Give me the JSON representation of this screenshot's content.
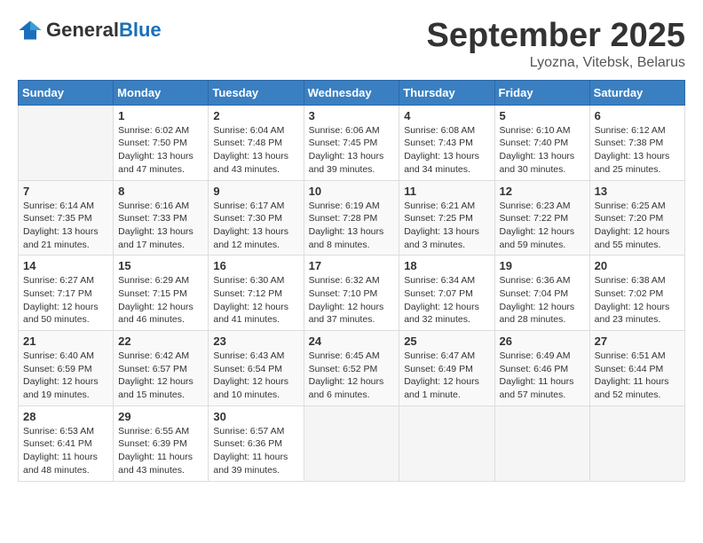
{
  "logo": {
    "general": "General",
    "blue": "Blue"
  },
  "header": {
    "month": "September 2025",
    "location": "Lyozna, Vitebsk, Belarus"
  },
  "weekdays": [
    "Sunday",
    "Monday",
    "Tuesday",
    "Wednesday",
    "Thursday",
    "Friday",
    "Saturday"
  ],
  "weeks": [
    [
      {
        "day": "",
        "info": ""
      },
      {
        "day": "1",
        "info": "Sunrise: 6:02 AM\nSunset: 7:50 PM\nDaylight: 13 hours and 47 minutes."
      },
      {
        "day": "2",
        "info": "Sunrise: 6:04 AM\nSunset: 7:48 PM\nDaylight: 13 hours and 43 minutes."
      },
      {
        "day": "3",
        "info": "Sunrise: 6:06 AM\nSunset: 7:45 PM\nDaylight: 13 hours and 39 minutes."
      },
      {
        "day": "4",
        "info": "Sunrise: 6:08 AM\nSunset: 7:43 PM\nDaylight: 13 hours and 34 minutes."
      },
      {
        "day": "5",
        "info": "Sunrise: 6:10 AM\nSunset: 7:40 PM\nDaylight: 13 hours and 30 minutes."
      },
      {
        "day": "6",
        "info": "Sunrise: 6:12 AM\nSunset: 7:38 PM\nDaylight: 13 hours and 25 minutes."
      }
    ],
    [
      {
        "day": "7",
        "info": "Sunrise: 6:14 AM\nSunset: 7:35 PM\nDaylight: 13 hours and 21 minutes."
      },
      {
        "day": "8",
        "info": "Sunrise: 6:16 AM\nSunset: 7:33 PM\nDaylight: 13 hours and 17 minutes."
      },
      {
        "day": "9",
        "info": "Sunrise: 6:17 AM\nSunset: 7:30 PM\nDaylight: 13 hours and 12 minutes."
      },
      {
        "day": "10",
        "info": "Sunrise: 6:19 AM\nSunset: 7:28 PM\nDaylight: 13 hours and 8 minutes."
      },
      {
        "day": "11",
        "info": "Sunrise: 6:21 AM\nSunset: 7:25 PM\nDaylight: 13 hours and 3 minutes."
      },
      {
        "day": "12",
        "info": "Sunrise: 6:23 AM\nSunset: 7:22 PM\nDaylight: 12 hours and 59 minutes."
      },
      {
        "day": "13",
        "info": "Sunrise: 6:25 AM\nSunset: 7:20 PM\nDaylight: 12 hours and 55 minutes."
      }
    ],
    [
      {
        "day": "14",
        "info": "Sunrise: 6:27 AM\nSunset: 7:17 PM\nDaylight: 12 hours and 50 minutes."
      },
      {
        "day": "15",
        "info": "Sunrise: 6:29 AM\nSunset: 7:15 PM\nDaylight: 12 hours and 46 minutes."
      },
      {
        "day": "16",
        "info": "Sunrise: 6:30 AM\nSunset: 7:12 PM\nDaylight: 12 hours and 41 minutes."
      },
      {
        "day": "17",
        "info": "Sunrise: 6:32 AM\nSunset: 7:10 PM\nDaylight: 12 hours and 37 minutes."
      },
      {
        "day": "18",
        "info": "Sunrise: 6:34 AM\nSunset: 7:07 PM\nDaylight: 12 hours and 32 minutes."
      },
      {
        "day": "19",
        "info": "Sunrise: 6:36 AM\nSunset: 7:04 PM\nDaylight: 12 hours and 28 minutes."
      },
      {
        "day": "20",
        "info": "Sunrise: 6:38 AM\nSunset: 7:02 PM\nDaylight: 12 hours and 23 minutes."
      }
    ],
    [
      {
        "day": "21",
        "info": "Sunrise: 6:40 AM\nSunset: 6:59 PM\nDaylight: 12 hours and 19 minutes."
      },
      {
        "day": "22",
        "info": "Sunrise: 6:42 AM\nSunset: 6:57 PM\nDaylight: 12 hours and 15 minutes."
      },
      {
        "day": "23",
        "info": "Sunrise: 6:43 AM\nSunset: 6:54 PM\nDaylight: 12 hours and 10 minutes."
      },
      {
        "day": "24",
        "info": "Sunrise: 6:45 AM\nSunset: 6:52 PM\nDaylight: 12 hours and 6 minutes."
      },
      {
        "day": "25",
        "info": "Sunrise: 6:47 AM\nSunset: 6:49 PM\nDaylight: 12 hours and 1 minute."
      },
      {
        "day": "26",
        "info": "Sunrise: 6:49 AM\nSunset: 6:46 PM\nDaylight: 11 hours and 57 minutes."
      },
      {
        "day": "27",
        "info": "Sunrise: 6:51 AM\nSunset: 6:44 PM\nDaylight: 11 hours and 52 minutes."
      }
    ],
    [
      {
        "day": "28",
        "info": "Sunrise: 6:53 AM\nSunset: 6:41 PM\nDaylight: 11 hours and 48 minutes."
      },
      {
        "day": "29",
        "info": "Sunrise: 6:55 AM\nSunset: 6:39 PM\nDaylight: 11 hours and 43 minutes."
      },
      {
        "day": "30",
        "info": "Sunrise: 6:57 AM\nSunset: 6:36 PM\nDaylight: 11 hours and 39 minutes."
      },
      {
        "day": "",
        "info": ""
      },
      {
        "day": "",
        "info": ""
      },
      {
        "day": "",
        "info": ""
      },
      {
        "day": "",
        "info": ""
      }
    ]
  ]
}
